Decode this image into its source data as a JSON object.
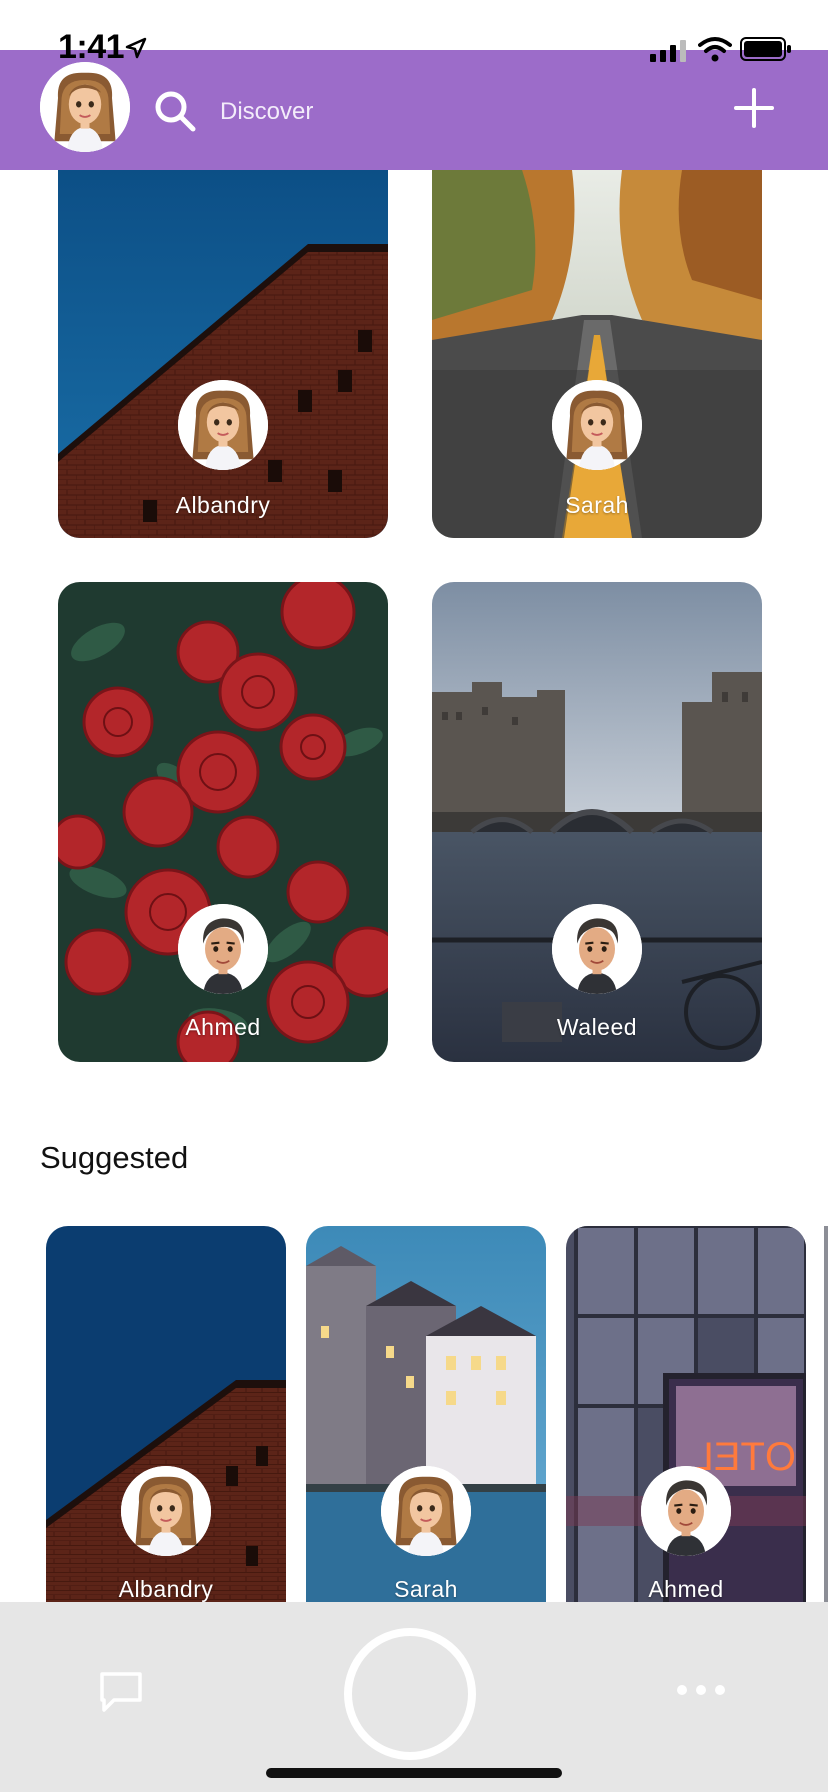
{
  "status_bar": {
    "time": "1:41"
  },
  "header": {
    "search_label": "Discover",
    "accent_color": "#9c6cc9",
    "icons": [
      "avatar",
      "search-icon",
      "plus-icon"
    ]
  },
  "feed": {
    "cards": [
      {
        "name": "Albandry",
        "avatar": "female",
        "photo": "brick-building-sky"
      },
      {
        "name": "Sarah",
        "avatar": "female",
        "photo": "autumn-road"
      },
      {
        "name": "Ahmed",
        "avatar": "male",
        "photo": "red-roses"
      },
      {
        "name": "Waleed",
        "avatar": "male",
        "photo": "canal-bridge"
      }
    ]
  },
  "suggested": {
    "title": "Suggested",
    "cards": [
      {
        "name": "Albandry",
        "avatar": "female",
        "photo": "brick-building-sky"
      },
      {
        "name": "Sarah",
        "avatar": "female",
        "photo": "canal-houses"
      },
      {
        "name": "Ahmed",
        "avatar": "male",
        "photo": "hotel-sign"
      }
    ]
  },
  "bottom_bar": {
    "icons": [
      "chat-icon",
      "capture-button",
      "more-icon"
    ]
  }
}
